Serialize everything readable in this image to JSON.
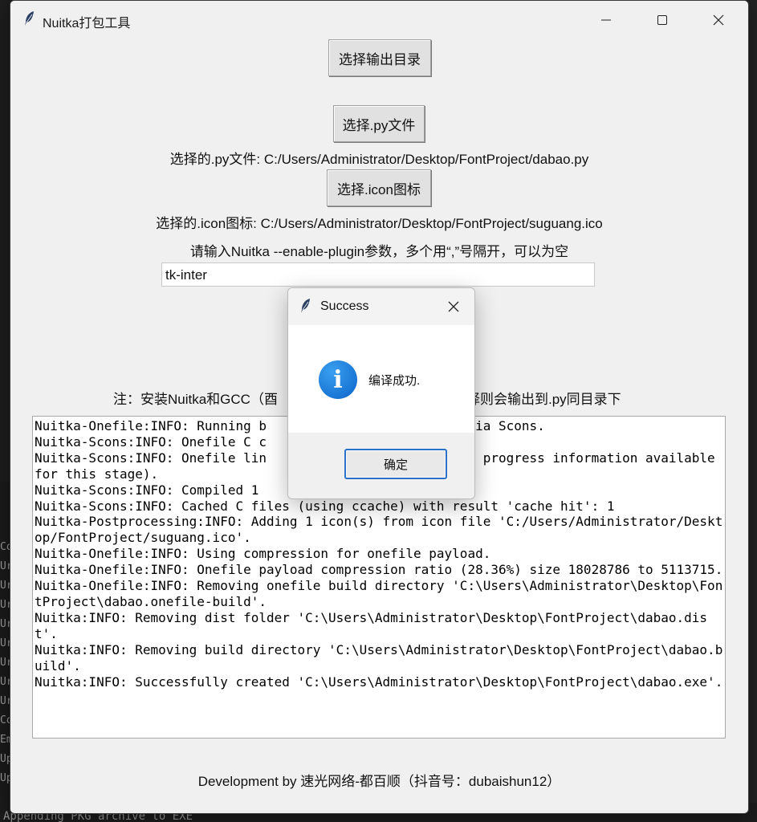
{
  "window": {
    "title": "Nuitka打包工具"
  },
  "buttons": {
    "select_output_dir": "选择输出目录",
    "select_py": "选择.py文件",
    "select_icon": "选择.icon图标"
  },
  "labels": {
    "selected_py": "选择的.py文件: C:/Users/Administrator/Desktop/FontProject/dabao.py",
    "selected_icon": "选择的.icon图标: C:/Users/Administrator/Desktop/FontProject/suguang.ico",
    "plugin_prompt": "请输入Nuitka --enable-plugin参数，多个用“,”号隔开，可以为空",
    "note_left": "注：安装Nuitka和GCC（酉",
    "note_right": "择则会输出到.py同目录下",
    "footer": "Development by 速光网络-都百顺（抖音号：dubaishun12）"
  },
  "plugin_input": {
    "value": "tk-inter"
  },
  "log_lines": [
    "Nuitka-Onefile:INFO: Running b                   lation via Scons.",
    "Nuitka-Scons:INFO: Onefile C c                   2.0).",
    "Nuitka-Scons:INFO: Onefile lin                   iles (no progress information available for this stage).",
    "Nuitka-Scons:INFO: Compiled 1",
    "Nuitka-Scons:INFO: Cached C files (using ccache) with result 'cache hit': 1",
    "Nuitka-Postprocessing:INFO: Adding 1 icon(s) from icon file 'C:/Users/Administrator/Desktop/FontProject/suguang.ico'.",
    "Nuitka-Onefile:INFO: Using compression for onefile payload.",
    "Nuitka-Onefile:INFO: Onefile payload compression ratio (28.36%) size 18028786 to 5113715.",
    "Nuitka-Onefile:INFO: Removing onefile build directory 'C:\\Users\\Administrator\\Desktop\\FontProject\\dabao.onefile-build'.",
    "Nuitka:INFO: Removing dist folder 'C:\\Users\\Administrator\\Desktop\\FontProject\\dabao.dist'.",
    "Nuitka:INFO: Removing build directory 'C:\\Users\\Administrator\\Desktop\\FontProject\\dabao.build'.",
    "Nuitka:INFO: Successfully created 'C:\\Users\\Administrator\\Desktop\\FontProject\\dabao.exe'."
  ],
  "dialog": {
    "title": "Success",
    "message": "编译成功.",
    "ok_label": "确定",
    "icon": "info-icon"
  },
  "background": {
    "left_strip": [
      "Co",
      "Ur",
      "Ur",
      "Ur",
      "Ur",
      "Ur",
      "Ur",
      "Ur",
      "Ur",
      "Co",
      "Em",
      "Up",
      "Up"
    ],
    "bottom_text": "Appending PKG archive to EXE"
  },
  "icons": {
    "app": "feather-icon",
    "minimize": "minimize-icon",
    "maximize": "maximize-icon",
    "close": "close-icon"
  }
}
